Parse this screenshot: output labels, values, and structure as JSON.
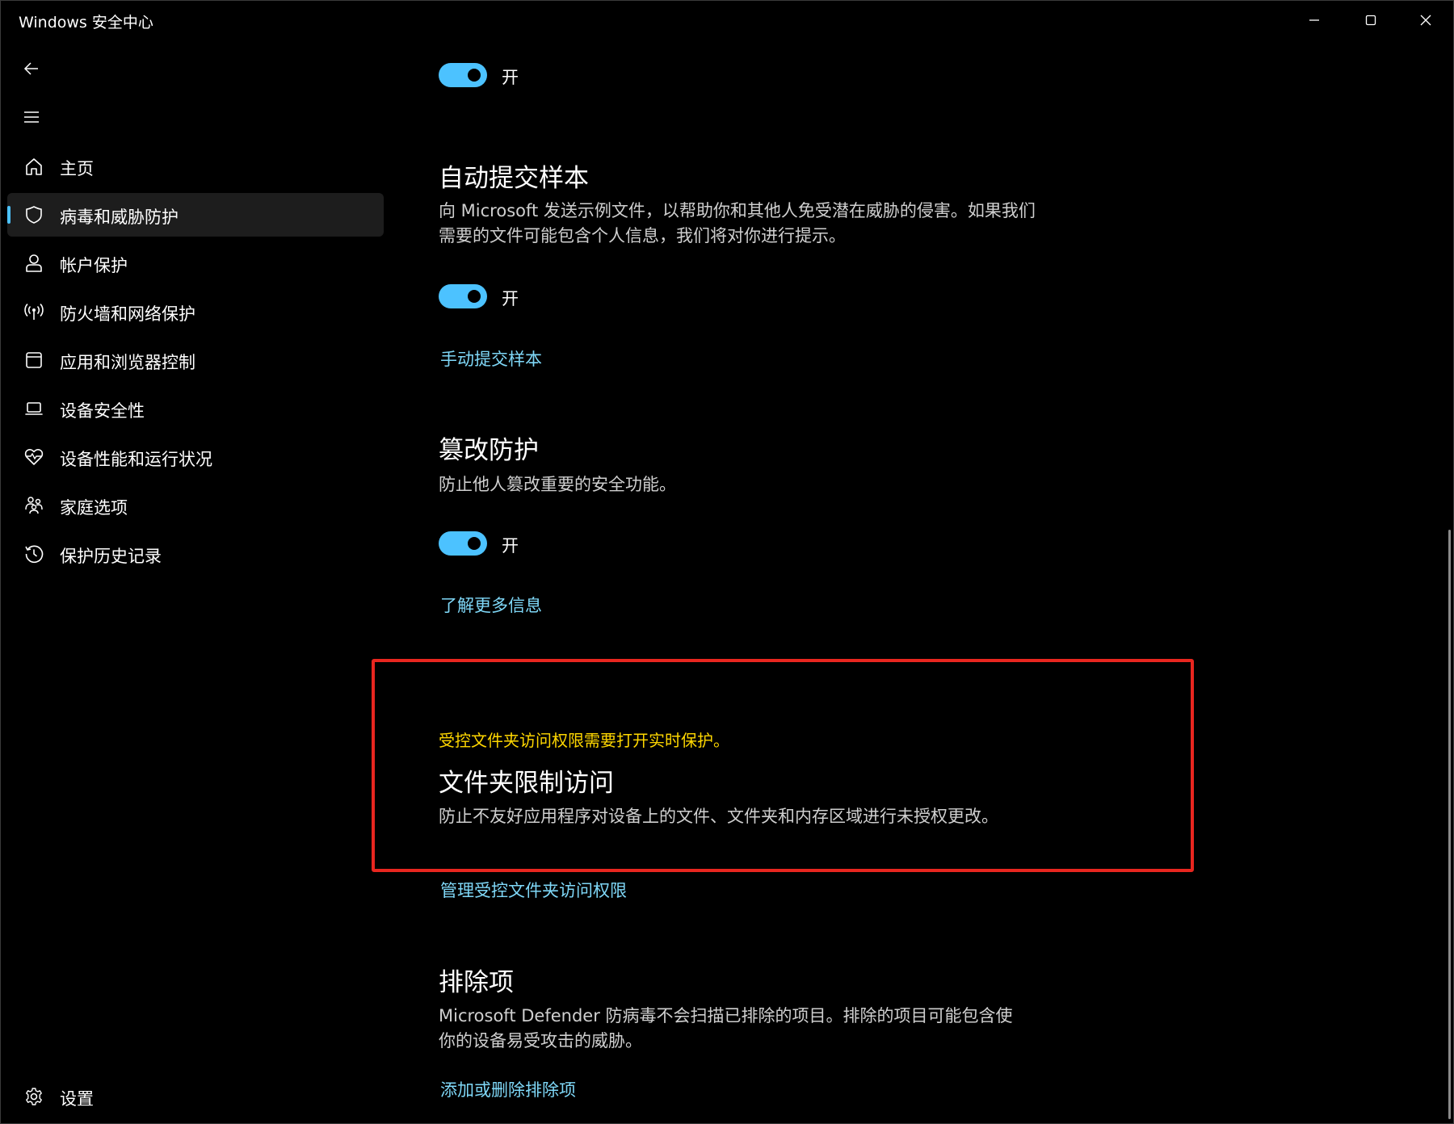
{
  "window": {
    "title": "Windows 安全中心"
  },
  "sidebar": {
    "items": [
      {
        "label": "主页",
        "icon": "home-icon"
      },
      {
        "label": "病毒和威胁防护",
        "icon": "shield-icon",
        "selected": true
      },
      {
        "label": "帐户保护",
        "icon": "person-icon"
      },
      {
        "label": "防火墙和网络保护",
        "icon": "wifi-signal-icon"
      },
      {
        "label": "应用和浏览器控制",
        "icon": "app-window-icon"
      },
      {
        "label": "设备安全性",
        "icon": "laptop-icon"
      },
      {
        "label": "设备性能和运行状况",
        "icon": "heart-pulse-icon"
      },
      {
        "label": "家庭选项",
        "icon": "family-icon"
      },
      {
        "label": "保护历史记录",
        "icon": "history-icon"
      }
    ],
    "settings_label": "设置"
  },
  "content": {
    "top_toggle": {
      "state_label": "开",
      "on": true
    },
    "auto_submit": {
      "title": "自动提交样本",
      "description": "向 Microsoft 发送示例文件，以帮助你和其他人免受潜在威胁的侵害。如果我们需要的文件可能包含个人信息，我们将对你进行提示。",
      "toggle_label": "开",
      "link": "手动提交样本"
    },
    "tamper": {
      "title": "篡改防护",
      "description": "防止他人篡改重要的安全功能。",
      "toggle_label": "开",
      "link": "了解更多信息"
    },
    "cfa": {
      "warning": "受控文件夹访问权限需要打开实时保护。",
      "title": "文件夹限制访问",
      "description": "防止不友好应用程序对设备上的文件、文件夹和内存区域进行未授权更改。",
      "link": "管理受控文件夹访问权限"
    },
    "exclusions": {
      "title": "排除项",
      "description": "Microsoft Defender 防病毒不会扫描已排除的项目。排除的项目可能包含使你的设备易受攻击的威胁。",
      "link": "添加或删除排除项"
    }
  },
  "colors": {
    "accent": "#4cc2ff",
    "link": "#7fd8f8",
    "warning": "#ffd700",
    "highlight_border": "#e8261f",
    "background": "#000000"
  }
}
